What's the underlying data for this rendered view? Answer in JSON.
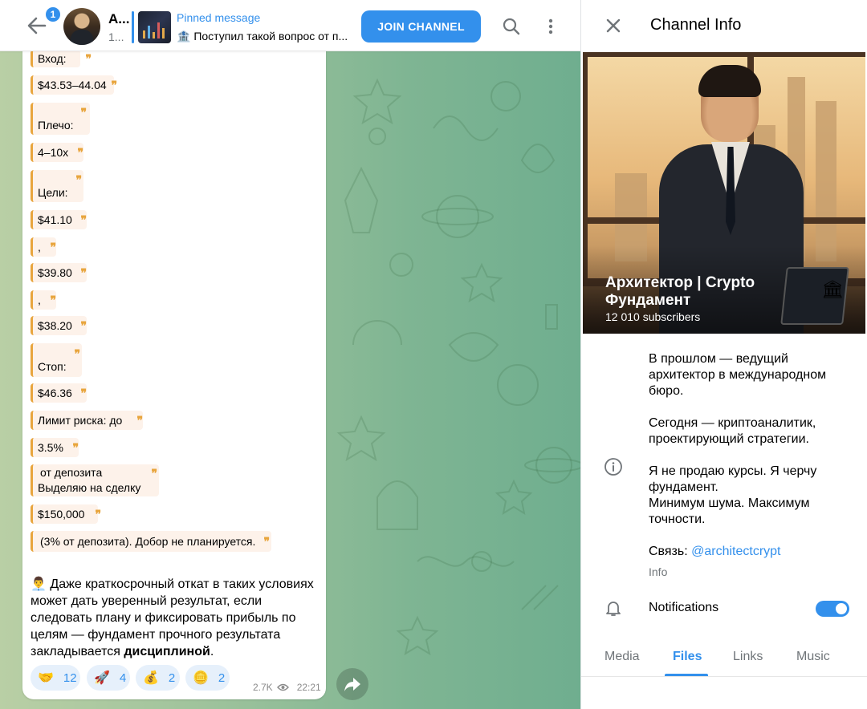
{
  "header": {
    "back_badge": "1",
    "channel_title": "А...",
    "channel_sub": "1...",
    "pinned_label": "Pinned message",
    "pinned_text": "🏦 Поступил такой вопрос от п...",
    "join_label": "JOIN CHANNEL",
    "icons": [
      "back-arrow-icon",
      "search-icon",
      "more-vertical-icon"
    ]
  },
  "message": {
    "quote_lines": [
      "Вход:",
      "$43.53–44.04",
      "Плечо:",
      "4–10x",
      "Цели:",
      "$41.10",
      ",",
      "$39.80",
      ",",
      "$38.20",
      "Стоп:",
      "$46.36",
      "Лимит риска: до",
      "3.5%",
      "от депозита",
      "Выделяю на сделку",
      "$150,000",
      "(3% от депозита). Добор не планируется."
    ],
    "body_emoji": "👨‍💼",
    "body_text": "Даже краткосрочный откат в таких условиях может дать уверенный результат, если следовать плану и фиксировать прибыль по целям — фундамент прочного результата закладывается ",
    "body_bold": "дисциплиной",
    "body_end": ".",
    "reactions": [
      {
        "emoji": "🤝",
        "count": "12"
      },
      {
        "emoji": "🚀",
        "count": "4"
      },
      {
        "emoji": "💰",
        "count": "2"
      },
      {
        "emoji": "🪙",
        "count": "2"
      }
    ],
    "views": "2.7K",
    "time": "22:21"
  },
  "info": {
    "title": "Channel Info",
    "name": "Архитектор | Crypto Фундамент",
    "subscribers": "12 010 subscribers",
    "desc_p1": "В прошлом — ведущий архитектор в международном бюро.",
    "desc_p2": "Сегодня — криптоаналитик, проектирующий стратегии.",
    "desc_p3a": "Я не продаю курсы. Я черчу фундамент.",
    "desc_p3b": "Минимум шума. Максимум точности.",
    "contact_prefix": "Связь: ",
    "contact_link": "@architectcrypt",
    "info_label": "Info",
    "notifications_label": "Notifications",
    "notifications_on": true,
    "tabs": [
      "Media",
      "Files",
      "Links",
      "Music"
    ],
    "active_tab": "Files"
  },
  "colors": {
    "accent": "#3390ec",
    "quote_bar": "#e8a53d",
    "quote_bg": "#fdf2ea"
  }
}
